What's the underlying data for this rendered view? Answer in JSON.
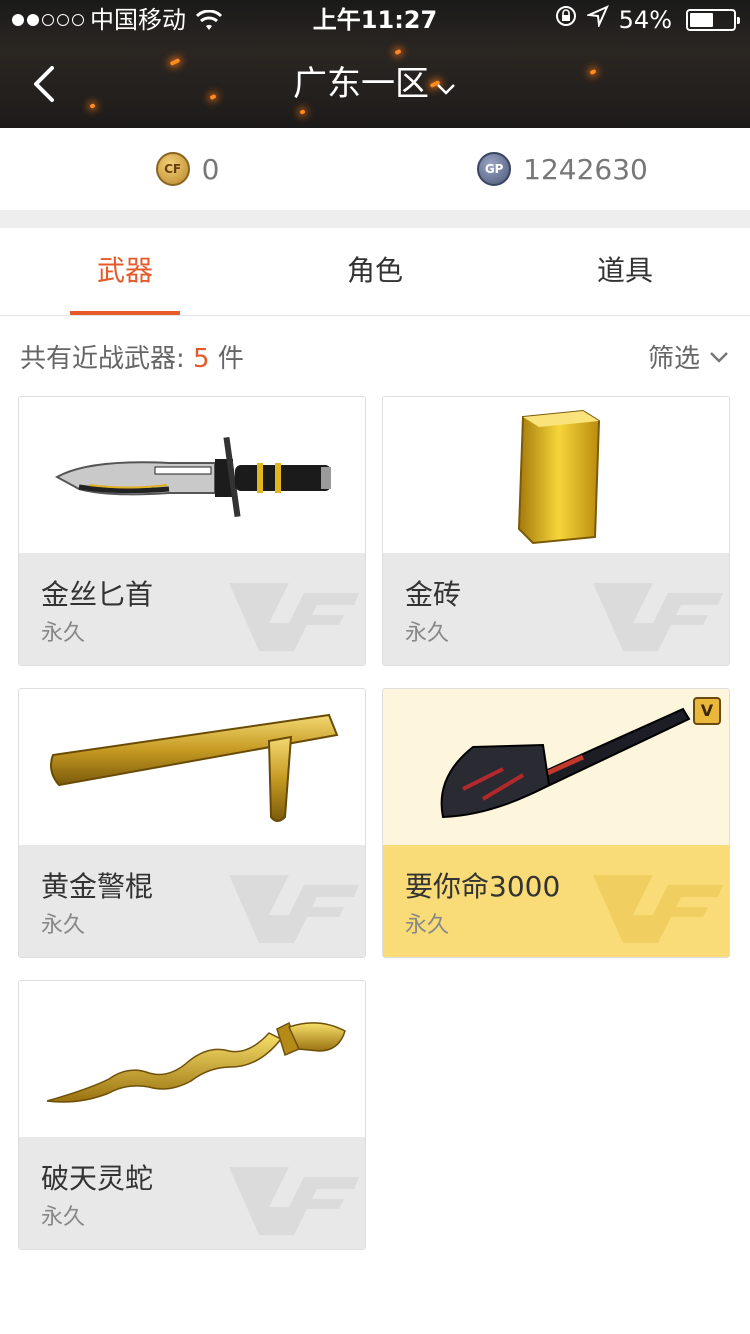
{
  "status_bar": {
    "carrier": "中国移动",
    "time": "上午11:27",
    "battery": "54%",
    "battery_level": 0.54
  },
  "nav": {
    "region": "广东一区",
    "back_icon": "chevron-left-icon",
    "dropdown_icon": "chevron-down-icon"
  },
  "currency": {
    "cf_points": "0",
    "gp": "1242630",
    "cf_icon": "cf-coin-icon",
    "gp_icon_label": "GP"
  },
  "tabs": [
    {
      "label": "武器",
      "active": true
    },
    {
      "label": "角色",
      "active": false
    },
    {
      "label": "道具",
      "active": false
    }
  ],
  "summary": {
    "prefix": "共有近战武器: ",
    "count": "5",
    "suffix": " 件",
    "filter_label": "筛选"
  },
  "items": [
    {
      "name": "金丝匕首",
      "duration": "永久",
      "vip": false,
      "icon": "knife-icon"
    },
    {
      "name": "金砖",
      "duration": "永久",
      "vip": false,
      "icon": "gold-brick-icon"
    },
    {
      "name": "黄金警棍",
      "duration": "永久",
      "vip": false,
      "icon": "baton-icon"
    },
    {
      "name": "要你命3000",
      "duration": "永久",
      "vip": true,
      "icon": "shovel-icon",
      "badge": "V"
    },
    {
      "name": "破天灵蛇",
      "duration": "永久",
      "vip": false,
      "icon": "kris-icon"
    }
  ],
  "colors": {
    "accent": "#e55a2b",
    "vip_card": "#f9dc77",
    "card_info_bg": "#e8e8e8"
  }
}
